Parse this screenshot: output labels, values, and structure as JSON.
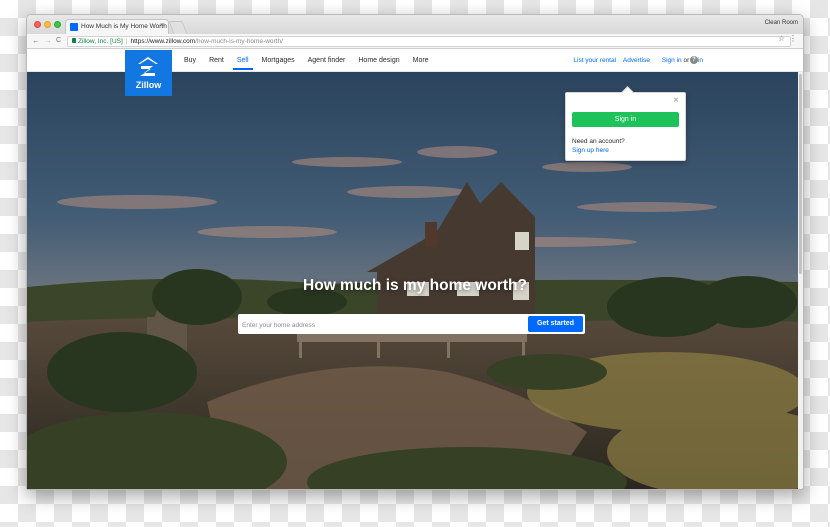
{
  "browser": {
    "tab_title": "How Much is My Home Worth",
    "tab_close": "×",
    "profile_name": "Clean Room",
    "secure_label": "Zillow, Inc. [US]",
    "url_host": "https://www.zillow.com",
    "url_path": "/how-much-is-my-home-worth/",
    "back": "←",
    "forward": "→",
    "reload": "C",
    "star": "☆",
    "menu": "⋮"
  },
  "site": {
    "logo_text": "Zillow",
    "nav": [
      {
        "label": "Buy"
      },
      {
        "label": "Rent"
      },
      {
        "label": "Sell"
      },
      {
        "label": "Mortgages"
      },
      {
        "label": "Agent finder"
      },
      {
        "label": "Home design"
      },
      {
        "label": "More"
      }
    ],
    "active_nav": "Sell",
    "right_nav": {
      "list_rental": "List your rental",
      "advertise": "Advertise",
      "sign_in": "Sign in",
      "or": "or",
      "join": "Join",
      "help": "?"
    }
  },
  "hero": {
    "headline": "How much is my home worth?",
    "search_placeholder": "Enter your home address",
    "cta": "Get started"
  },
  "popover": {
    "close": "×",
    "sign_in_button": "Sign in",
    "question": "Need an account?",
    "signup_link": "Sign up here"
  },
  "colors": {
    "brand_blue": "#006aff",
    "logo_blue": "#1277e1",
    "signin_green": "#1ec25a"
  }
}
